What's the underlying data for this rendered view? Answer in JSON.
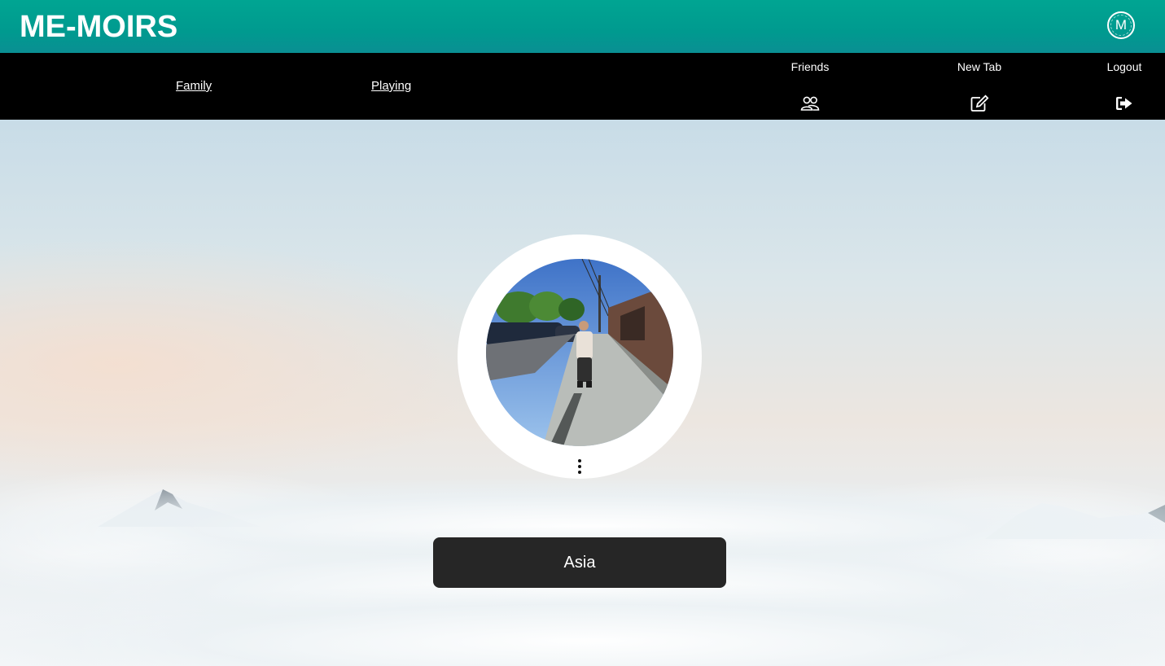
{
  "header": {
    "logo": "ME-MOIRS",
    "avatar_initial": "M"
  },
  "nav": {
    "links": [
      {
        "label": "Family"
      },
      {
        "label": "Playing"
      }
    ],
    "actions": [
      {
        "label": "Friends",
        "icon": "users-icon"
      },
      {
        "label": "New Tab",
        "icon": "edit-icon"
      },
      {
        "label": "Logout",
        "icon": "sign-out-icon"
      }
    ]
  },
  "profile": {
    "name": "Asia",
    "menu_icon": "vertical-ellipsis-icon"
  },
  "colors": {
    "header": "#00a592",
    "nav": "#000000",
    "name_box": "#262626"
  }
}
